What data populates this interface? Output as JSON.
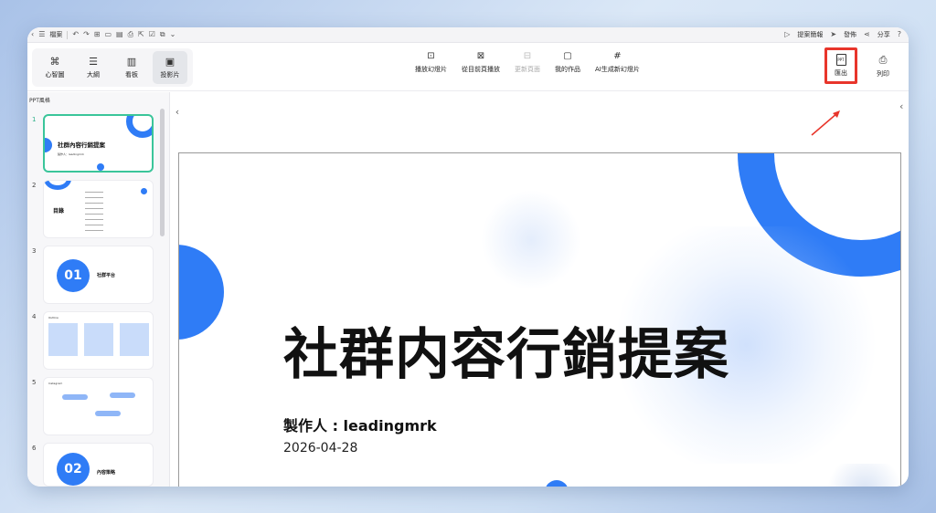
{
  "titlebar": {
    "file_label": "檔案",
    "present_mode_label": "提案簡報",
    "publish_label": "發佈",
    "share_label": "分享"
  },
  "views": [
    {
      "label": "心智圖",
      "icon": "mindmap-icon",
      "glyph": "⌘"
    },
    {
      "label": "大綱",
      "icon": "outline-icon",
      "glyph": "☰"
    },
    {
      "label": "看板",
      "icon": "kanban-icon",
      "glyph": "▥"
    },
    {
      "label": "投影片",
      "icon": "slides-icon",
      "glyph": "▣"
    }
  ],
  "actions": [
    {
      "label": "播放幻燈片",
      "icon": "play-slideshow-icon",
      "glyph": "⊡"
    },
    {
      "label": "從目前頁播放",
      "icon": "play-from-current-icon",
      "glyph": "⊠"
    },
    {
      "label": "更新頁面",
      "icon": "update-page-icon",
      "glyph": "⊟",
      "disabled": true
    },
    {
      "label": "我的作品",
      "icon": "my-works-icon",
      "glyph": "▢"
    },
    {
      "label": "AI生成新幻燈片",
      "icon": "ai-generate-icon",
      "glyph": "#"
    }
  ],
  "right_actions": {
    "export_label": "匯出",
    "export_icon_text": "PPT",
    "print_label": "列印"
  },
  "sidebar": {
    "title": "PPT風格",
    "slides": [
      {
        "num": "1",
        "title": "社群內容行銷提案",
        "sub": "製作人：leadingmrk"
      },
      {
        "num": "2",
        "title": "目錄"
      },
      {
        "num": "3",
        "title": "社群平台",
        "badge": "01"
      },
      {
        "num": "4",
        "title": "Outline"
      },
      {
        "num": "5",
        "title": "Instagram"
      },
      {
        "num": "6",
        "title": "內容策略",
        "badge": "02"
      }
    ]
  },
  "slide": {
    "title": "社群内容行銷提案",
    "author": "製作人 : leadingmrk",
    "date": "2026-04-28"
  },
  "colors": {
    "accent_blue": "#2f7cf6",
    "highlight_red": "#e8352b",
    "active_green": "#3ac59a"
  }
}
